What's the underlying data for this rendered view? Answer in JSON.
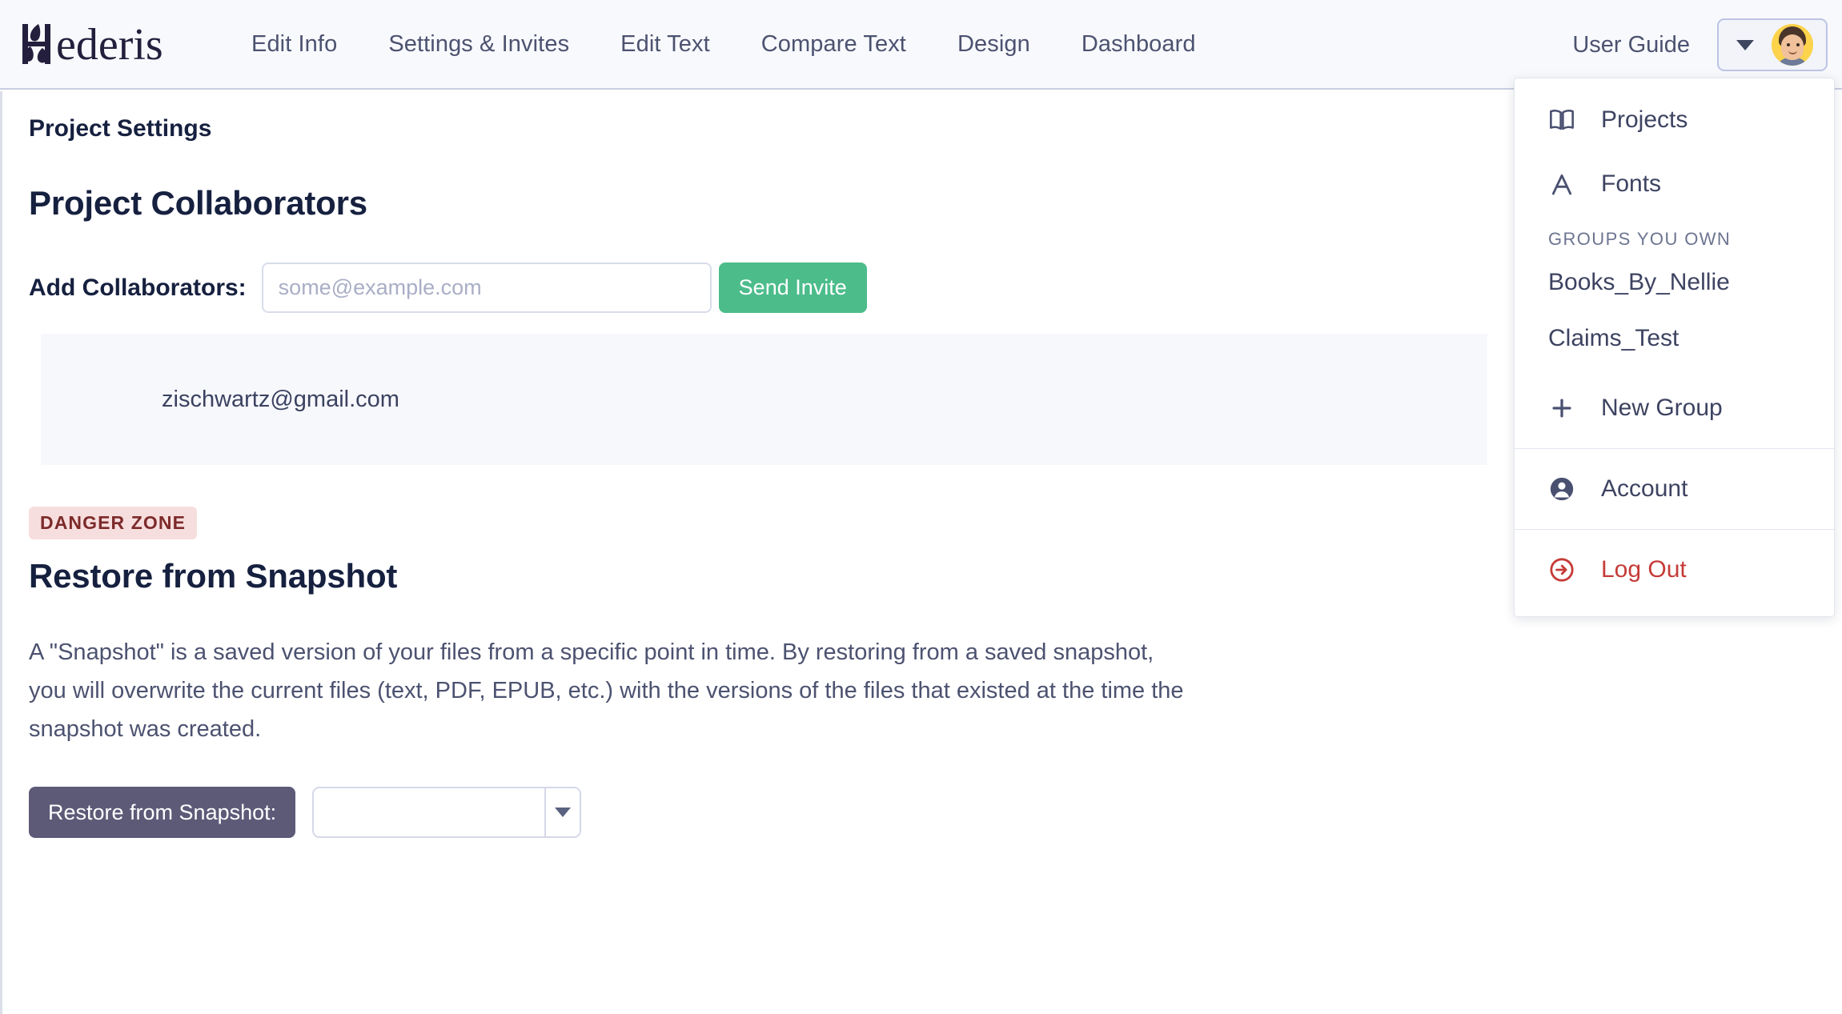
{
  "header": {
    "brand": "Hederis",
    "brand_icon": "ivy-leaf-h-logo",
    "nav": [
      {
        "label": "Edit Info"
      },
      {
        "label": "Settings & Invites"
      },
      {
        "label": "Edit Text"
      },
      {
        "label": "Compare Text"
      },
      {
        "label": "Design"
      },
      {
        "label": "Dashboard"
      }
    ],
    "user_guide": "User Guide",
    "avatar_caret_icon": "caret-down-icon",
    "avatar_icon": "user-avatar-photo"
  },
  "dropdown": {
    "items": [
      {
        "label": "Projects",
        "icon": "open-book-icon"
      },
      {
        "label": "Fonts",
        "icon": "letter-a-icon"
      }
    ],
    "group_heading": "GROUPS YOU OWN",
    "groups": [
      {
        "label": "Books_By_Nellie"
      },
      {
        "label": "Claims_Test"
      }
    ],
    "new_group": {
      "label": "New Group",
      "icon": "plus-icon"
    },
    "account": {
      "label": "Account",
      "icon": "account-circle-icon"
    },
    "logout": {
      "label": "Log Out",
      "icon": "logout-arrow-icon",
      "color": "#c53b37"
    }
  },
  "main": {
    "page_title": "Project Settings",
    "collaborators": {
      "section_title": "Project Collaborators",
      "add_label": "Add Collaborators:",
      "input_value": "",
      "input_placeholder": "some@example.com",
      "send_invite_label": "Send Invite",
      "send_invite_color": "#4cbc8b",
      "list": [
        {
          "email": "zischwartz@gmail.com"
        }
      ]
    },
    "danger": {
      "badge": "DANGER ZONE",
      "badge_bg": "#f7dede",
      "badge_color": "#7d2a2a",
      "title": "Restore from Snapshot",
      "description": "A \"Snapshot\" is a saved version of your files from a specific point in time. By restoring from a saved snapshot, you will overwrite the current files (text, PDF, EPUB, etc.) with the versions of the files that existed at the time the snapshot was created.",
      "restore_button": "Restore from Snapshot:",
      "restore_button_color": "#5d5a78",
      "snapshot_select_value": "",
      "snapshot_select_icon": "chevron-down-icon"
    }
  }
}
